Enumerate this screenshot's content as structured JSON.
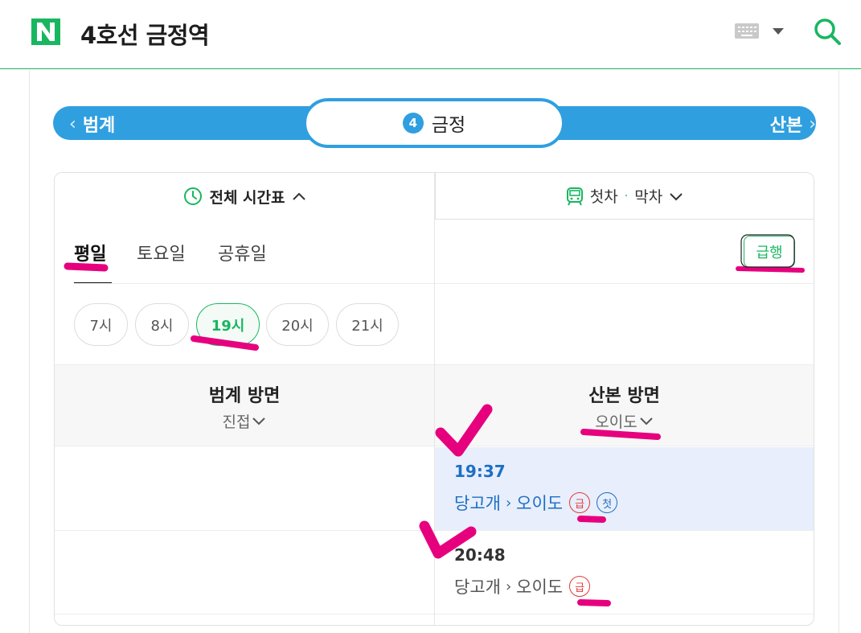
{
  "header": {
    "title": "4호선 금정역",
    "logo": "N"
  },
  "station_nav": {
    "prev": "범계",
    "current": "금정",
    "line_number": "4",
    "next": "산본",
    "line_color": "#2f9fe0"
  },
  "tabs": {
    "all_timetable": "전체 시간표",
    "first_last_first": "첫차",
    "first_last_sep": "·",
    "first_last_last": "막차"
  },
  "day_tabs": [
    {
      "label": "평일",
      "active": true
    },
    {
      "label": "토요일",
      "active": false
    },
    {
      "label": "공휴일",
      "active": false
    }
  ],
  "express_button": "급행",
  "hours": [
    {
      "label": "7시",
      "active": false
    },
    {
      "label": "8시",
      "active": false
    },
    {
      "label": "19시",
      "active": true
    },
    {
      "label": "20시",
      "active": false
    },
    {
      "label": "21시",
      "active": false
    }
  ],
  "directions": [
    {
      "name": "범계 방면",
      "sub": "진접"
    },
    {
      "name": "산본 방면",
      "sub": "오이도"
    }
  ],
  "timetable": [
    {
      "time": "19:37",
      "from": "당고개",
      "to": "오이도",
      "badges": [
        "급",
        "첫"
      ],
      "highlight": true
    },
    {
      "time": "20:48",
      "from": "당고개",
      "to": "오이도",
      "badges": [
        "급"
      ],
      "highlight": false
    }
  ],
  "colors": {
    "brand_green": "#19b660",
    "line4_blue": "#2f9fe0",
    "annotation_pink": "#e6007e"
  }
}
